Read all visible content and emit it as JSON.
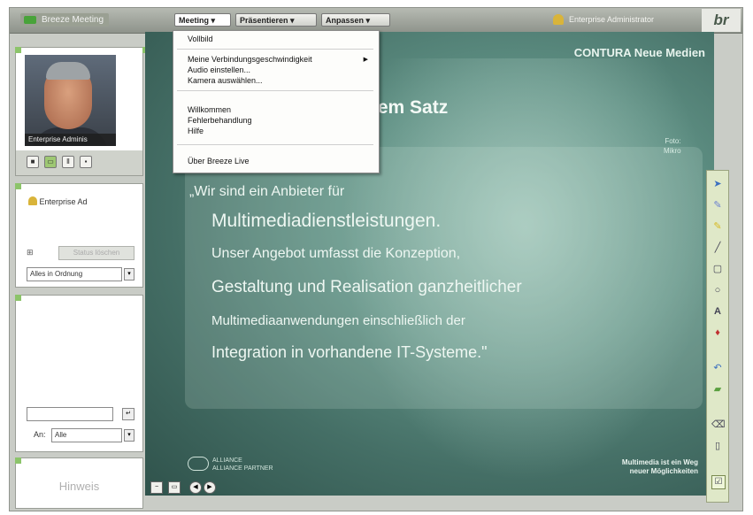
{
  "app": {
    "name": "Breeze Meeting",
    "menus": [
      "Meeting",
      "Präsentieren",
      "Anpassen"
    ],
    "user": "Enterprise Administrator",
    "logo": "br"
  },
  "meeting_menu": {
    "items": [
      {
        "label": "Vollbild"
      },
      {
        "label": "Meine Verbindungsgeschwindigkeit",
        "submenu": true
      },
      {
        "label": "Audio einstellen..."
      },
      {
        "label": "Kamera auswählen..."
      },
      {
        "label": "Willkommen"
      },
      {
        "label": "Fehlerbehandlung"
      },
      {
        "label": "Hilfe"
      },
      {
        "label": "Über Breeze Live"
      }
    ]
  },
  "camera_pod": {
    "participant_label": "Enterprise Adminis"
  },
  "attendee_pod": {
    "attendee": "Enterprise Ad",
    "status_button": "Status löschen",
    "status_value": "Alles in Ordnung"
  },
  "chat_pod": {
    "input_value": "",
    "to_label": "An:",
    "to_value": "Alle"
  },
  "note_pod": {
    "text": "Hinweis"
  },
  "slide": {
    "brand": "CONTURA Neue Medien",
    "title": "hem Satz",
    "photo_caption_1": "Foto:",
    "photo_caption_2": "Mikro",
    "quote_lines": [
      "„Wir sind ein Anbieter für",
      "Multimediadienstleistungen.",
      "Unser Angebot umfasst die Konzeption,",
      "Gestaltung und Realisation ganzheitlicher",
      "Multimediaanwendungen einschließlich der",
      "Integration in vorhandene IT-Systeme.\""
    ],
    "partner_line_1": "ALLIANCE",
    "partner_line_2": "ALLIANCE PARTNER",
    "claim_line_1": "Multimedia ist ein Weg",
    "claim_line_2": "neuer Möglichkeiten"
  },
  "colors": {
    "accent_green": "#8cc46a",
    "slide_teal": "#5e8f83",
    "toolbar_bg": "#dfe8c8"
  },
  "icons": {
    "camera_controls": [
      "stop-icon",
      "camera-icon",
      "pause-icon",
      "lock-icon"
    ],
    "slide_tools": [
      "pointer-icon",
      "pencil-icon",
      "highlighter-icon",
      "line-icon",
      "rectangle-icon",
      "ellipse-icon",
      "text-icon",
      "stamp-icon",
      "undo-icon",
      "eraser-icon",
      "delete-icon",
      "page-icon",
      "done-icon"
    ]
  }
}
